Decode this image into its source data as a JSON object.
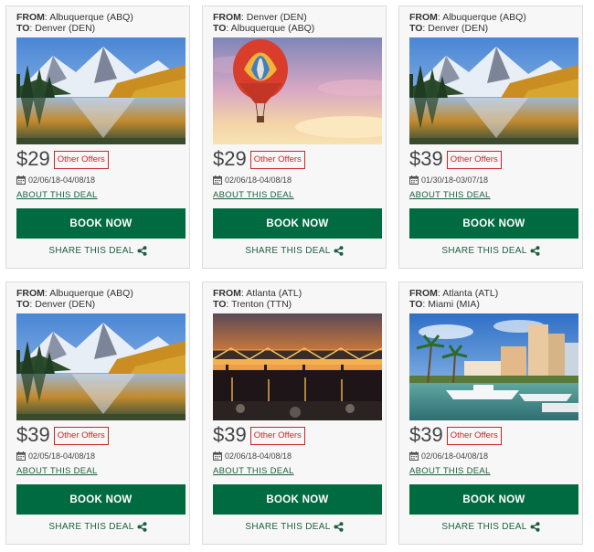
{
  "labels": {
    "from": "FROM",
    "to": "TO",
    "other_offers": "Other Offers",
    "about": "ABOUT THIS DEAL",
    "book": "BOOK NOW",
    "share": "SHARE THIS DEAL"
  },
  "colors": {
    "book_button": "#006b40",
    "offer_border": "#c8262b",
    "link": "#1e5e3f"
  },
  "deals": [
    {
      "from": "Albuquerque (ABQ)",
      "to": "Denver (DEN)",
      "price": "$29",
      "dates": "02/06/18-04/08/18",
      "image": "mountain-lake-photo"
    },
    {
      "from": "Denver (DEN)",
      "to": "Albuquerque (ABQ)",
      "price": "$29",
      "dates": "02/06/18-04/08/18",
      "image": "hot-air-balloon-photo"
    },
    {
      "from": "Albuquerque (ABQ)",
      "to": "Denver (DEN)",
      "price": "$39",
      "dates": "01/30/18-03/07/18",
      "image": "mountain-lake-photo"
    },
    {
      "from": "Albuquerque (ABQ)",
      "to": "Denver (DEN)",
      "price": "$39",
      "dates": "02/05/18-04/08/18",
      "image": "mountain-lake-photo"
    },
    {
      "from": "Atlanta (ATL)",
      "to": "Trenton (TTN)",
      "price": "$39",
      "dates": "02/06/18-04/08/18",
      "image": "bridge-night-photo"
    },
    {
      "from": "Atlanta (ATL)",
      "to": "Miami (MIA)",
      "price": "$39",
      "dates": "02/06/18-04/08/18",
      "image": "miami-marina-photo"
    }
  ]
}
